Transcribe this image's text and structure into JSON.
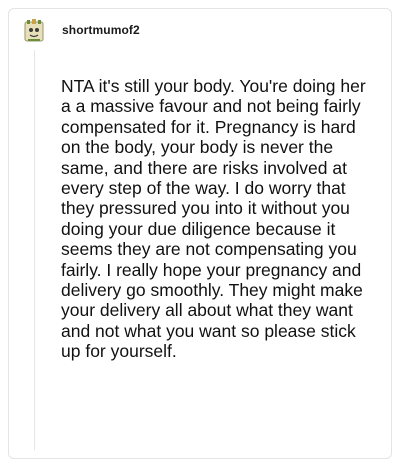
{
  "comment": {
    "username": "shortmumof2",
    "avatar_icon": "snoo-avatar-icon",
    "body": "NTA it's still your body. You're doing her a a massive favour and not being fairly compensated for it. Pregnancy is hard on the body, your body is never the same, and there are risks involved at every step of the way. I do worry that they pressured you into it without you doing your due diligence because it seems they are not compensating you fairly. I really hope your pregnancy and delivery go smoothly. They might make your delivery all about what they want and not what you want so please stick up for yourself."
  },
  "colors": {
    "text": "#111111",
    "username": "#1a1a1b",
    "thread_line": "#e6e6e6",
    "avatar_bg": "#e8e0b8",
    "avatar_accent": "#6a8f3a"
  }
}
